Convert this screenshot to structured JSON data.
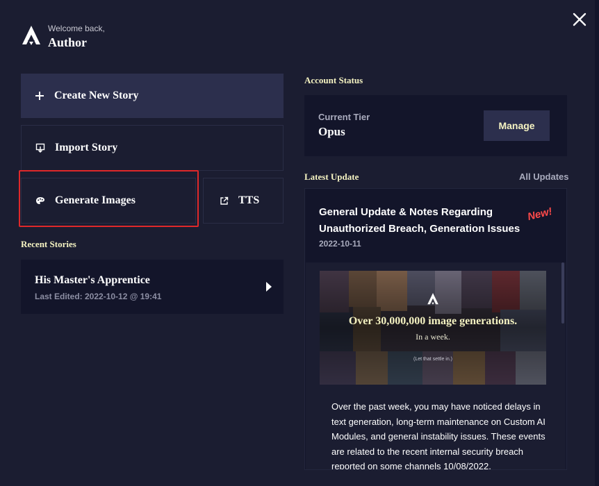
{
  "header": {
    "welcome_text": "Welcome back,",
    "username": "Author"
  },
  "actions": {
    "create_story": "Create New Story",
    "import_story": "Import Story",
    "generate_images": "Generate Images",
    "tts": "TTS"
  },
  "recent": {
    "section_title": "Recent Stories",
    "stories": [
      {
        "title": "His Master's Apprentice",
        "last_edited": "Last Edited: 2022-10-12 @ 19:41"
      }
    ]
  },
  "account": {
    "section_title": "Account Status",
    "tier_label": "Current Tier",
    "tier_value": "Opus",
    "manage_label": "Manage"
  },
  "updates": {
    "section_title": "Latest Update",
    "all_updates_label": "All Updates",
    "latest": {
      "title": "General Update & Notes Regarding Unauthorized Breach, Generation Issues",
      "badge": "New!",
      "date": "2022-10-11",
      "image_headline": "Over 30,000,000 image generations.",
      "image_subline": "In a week.",
      "image_footnote": "(Let that settle in.)",
      "body": "Over the past week, you may have noticed delays in text generation, long-term maintenance on Custom AI Modules, and general instability issues. These events are related to the recent internal security breach reported on some channels 10/08/2022."
    }
  },
  "icons": {
    "logo": "logo-icon",
    "close": "close-icon",
    "create": "plus-icon",
    "import": "import-icon",
    "generate": "palette-icon",
    "tts": "external-link-icon",
    "story_open": "chevron-right-icon"
  },
  "colors": {
    "background": "#1b1d31",
    "panel": "#13152a",
    "accent_button": "#2c2f4d",
    "heading_gold": "#f5f3c2",
    "highlight_red": "#e0282a",
    "new_badge": "#ff4a4a"
  }
}
